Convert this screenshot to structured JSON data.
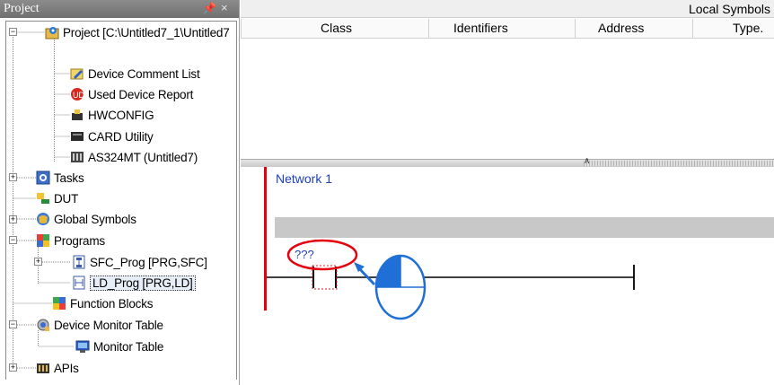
{
  "project_panel": {
    "title": "Project",
    "pin_glyph": "←",
    "close_glyph": "×",
    "items": [
      {
        "label": "Project [C:\\Untitled7_1\\Untitled7",
        "icon": "project-gear-icon"
      },
      {
        "label": "Device Comment List",
        "icon": "comment-icon"
      },
      {
        "label": "Used Device Report",
        "icon": "report-icon"
      },
      {
        "label": "HWCONFIG",
        "icon": "hwconfig-icon"
      },
      {
        "label": "CARD Utility",
        "icon": "card-icon"
      },
      {
        "label": "AS324MT  (Untitled7)",
        "icon": "plc-icon"
      },
      {
        "label": "Tasks",
        "icon": "tasks-icon"
      },
      {
        "label": "DUT",
        "icon": "dut-icon"
      },
      {
        "label": "Global Symbols",
        "icon": "global-symbols-icon"
      },
      {
        "label": "Programs",
        "icon": "programs-icon"
      },
      {
        "label": "SFC_Prog [PRG,SFC]",
        "icon": "sfc-icon"
      },
      {
        "label": "LD_Prog [PRG,LD]",
        "icon": "ld-icon"
      },
      {
        "label": "Function Blocks",
        "icon": "function-blocks-icon"
      },
      {
        "label": "Device Monitor Table",
        "icon": "device-monitor-icon"
      },
      {
        "label": "Monitor Table",
        "icon": "monitor-table-icon"
      },
      {
        "label": "APIs",
        "icon": "apis-icon"
      }
    ],
    "expanders": {
      "minus": "−",
      "plus": "+"
    }
  },
  "local_symbols": {
    "title": "Local Symbols",
    "columns": [
      "Class",
      "Identifiers",
      "Address",
      "Type."
    ]
  },
  "splitter": {
    "arrow": "∧"
  },
  "ladder": {
    "network_label": "Network 1",
    "contact_placeholder": "???"
  },
  "colors": {
    "panel_title_bg": "#7a7a7a",
    "rail": "#e3000f",
    "highlight_circle": "#e3000f",
    "pointer": "#1f6fd6",
    "network_text": "#1f3fbf"
  }
}
